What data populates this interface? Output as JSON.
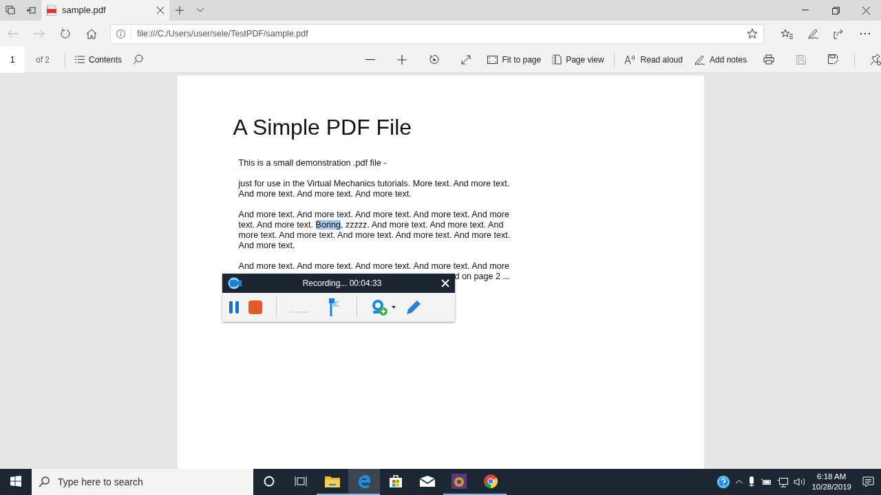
{
  "browser": {
    "tabs": [
      {
        "title": "sample.pdf",
        "selected": true
      }
    ],
    "address": "file:///C:/Users/user/sele/TestPDF/sample.pdf"
  },
  "pdf_toolbar": {
    "page": "1",
    "page_count": "of 2",
    "contents_label": "Contents",
    "tools": [
      {
        "kind": "zoom-out",
        "disabled": false
      },
      {
        "kind": "zoom-in",
        "disabled": false
      },
      {
        "kind": "rotate",
        "disabled": false
      },
      {
        "kind": "fullscreen",
        "disabled": false
      },
      {
        "kind": "fit",
        "label": "Fit to page",
        "disabled": false
      },
      {
        "kind": "pageview",
        "label": "Page view",
        "disabled": false
      },
      {
        "kind": "divider"
      },
      {
        "kind": "read",
        "label": "Read aloud",
        "disabled": false
      },
      {
        "kind": "notes",
        "label": "Add notes",
        "disabled": false
      },
      {
        "kind": "print",
        "disabled": false
      },
      {
        "kind": "save",
        "disabled": true
      },
      {
        "kind": "saveas",
        "disabled": false
      },
      {
        "kind": "divider"
      },
      {
        "kind": "pin",
        "disabled": false
      }
    ]
  },
  "document": {
    "title": "A Simple PDF File",
    "paragraphs": [
      {
        "segments": [
          {
            "text": "This is a small demonstration .pdf file -",
            "selected": false
          }
        ]
      },
      {
        "segments": [
          {
            "text": "just for use in the Virtual Mechanics tutorials. More text. And more text. And more text. And more text. And more text.",
            "selected": false
          }
        ]
      },
      {
        "segments": [
          {
            "text": "And more text. And more text. And more text. And more text. And more text. And more text. ",
            "selected": false
          },
          {
            "text": "Boring",
            "selected": true
          },
          {
            "text": ", zzzzz. And more text. And more text. And more text. And more text. And more text. And more text. And more text. And more text.",
            "selected": false
          }
        ]
      },
      {
        "segments": [
          {
            "text": "And more text. And more text. And more text. And more text. And more",
            "selected": false
          }
        ],
        "tail": "d on page 2 ..."
      }
    ]
  },
  "recorder": {
    "status": "Recording... 00:04:33"
  },
  "taskbar": {
    "search_placeholder": "Type here to search",
    "apps": [
      {
        "kind": "explorer",
        "running": true,
        "selected": false
      },
      {
        "kind": "edge",
        "running": true,
        "selected": true
      },
      {
        "kind": "store",
        "running": false,
        "selected": false
      },
      {
        "kind": "mail",
        "running": false,
        "selected": false
      },
      {
        "kind": "ide",
        "running": true,
        "selected": false
      },
      {
        "kind": "chrome",
        "running": true,
        "selected": false
      }
    ],
    "time": "6:18 AM",
    "date": "10/28/2019"
  }
}
